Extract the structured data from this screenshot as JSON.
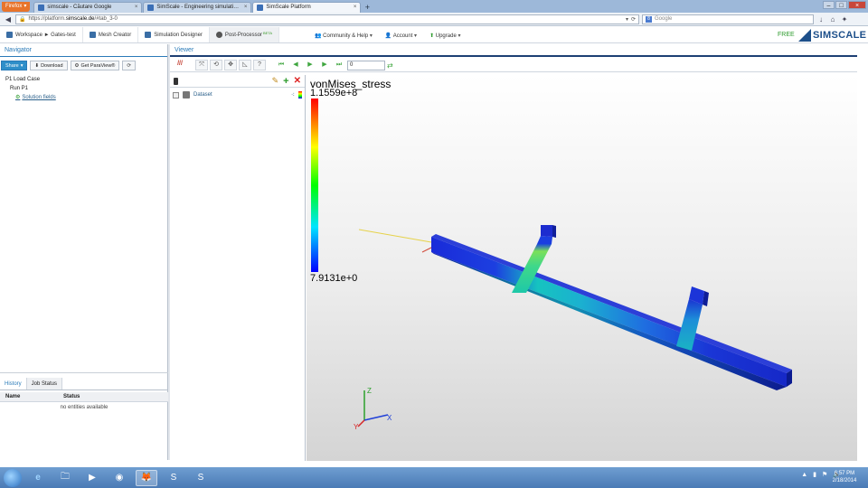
{
  "browser": {
    "menu_button": "Firefox",
    "tabs": [
      {
        "title": "simscale - Căutare Google",
        "active": false
      },
      {
        "title": "SimScale - Engineering simulation in ...",
        "active": false
      },
      {
        "title": "SimScale Platform",
        "active": true
      }
    ],
    "url_prefix": "https://platform.",
    "url_domain": "simscale.de",
    "url_suffix": "/#tab_3-0",
    "search_placeholder": "Google",
    "search_engine_badge": "8"
  },
  "app": {
    "nav": [
      {
        "label": "Workspace ► Gates-test",
        "icon": "workspace-icon"
      },
      {
        "label": "Mesh Creator",
        "icon": "mesh-icon"
      },
      {
        "label": "Simulation Designer",
        "icon": "simulation-icon"
      },
      {
        "label": "Post-Processor",
        "icon": "postprocessor-icon",
        "badge": "BETA"
      }
    ],
    "right_nav": [
      {
        "label": "Community & Help"
      },
      {
        "label": "Account"
      },
      {
        "label": "Upgrade"
      }
    ],
    "plan": "FREE",
    "logo_text": "SIMSCALE"
  },
  "navigator": {
    "title": "Navigator",
    "share": "Share",
    "download": "Download",
    "paraview": "Get ParaView®",
    "tree": {
      "load_case": "P1 Load Case",
      "run": "Run P1",
      "fields": "Solution fields"
    },
    "bottom_tabs": [
      "History",
      "Job Status"
    ],
    "table": {
      "col_name": "Name",
      "col_status": "Status",
      "empty": "no entities available"
    }
  },
  "viewer": {
    "title": "Viewer",
    "frame": "0",
    "pipeline": {
      "dataset": "Dataset"
    },
    "colorbar": {
      "field": "vonMises_stress",
      "max": "1.1559e+8",
      "min": "7.9131e+0"
    },
    "axes": {
      "x": "X",
      "y": "Y",
      "z": "Z"
    }
  },
  "taskbar": {
    "time": "6:57 PM",
    "date": "2/18/2014"
  },
  "colors": {
    "accent": "#2a7ab8",
    "free": "#2d9b2d",
    "logo": "#1d4f8a"
  }
}
